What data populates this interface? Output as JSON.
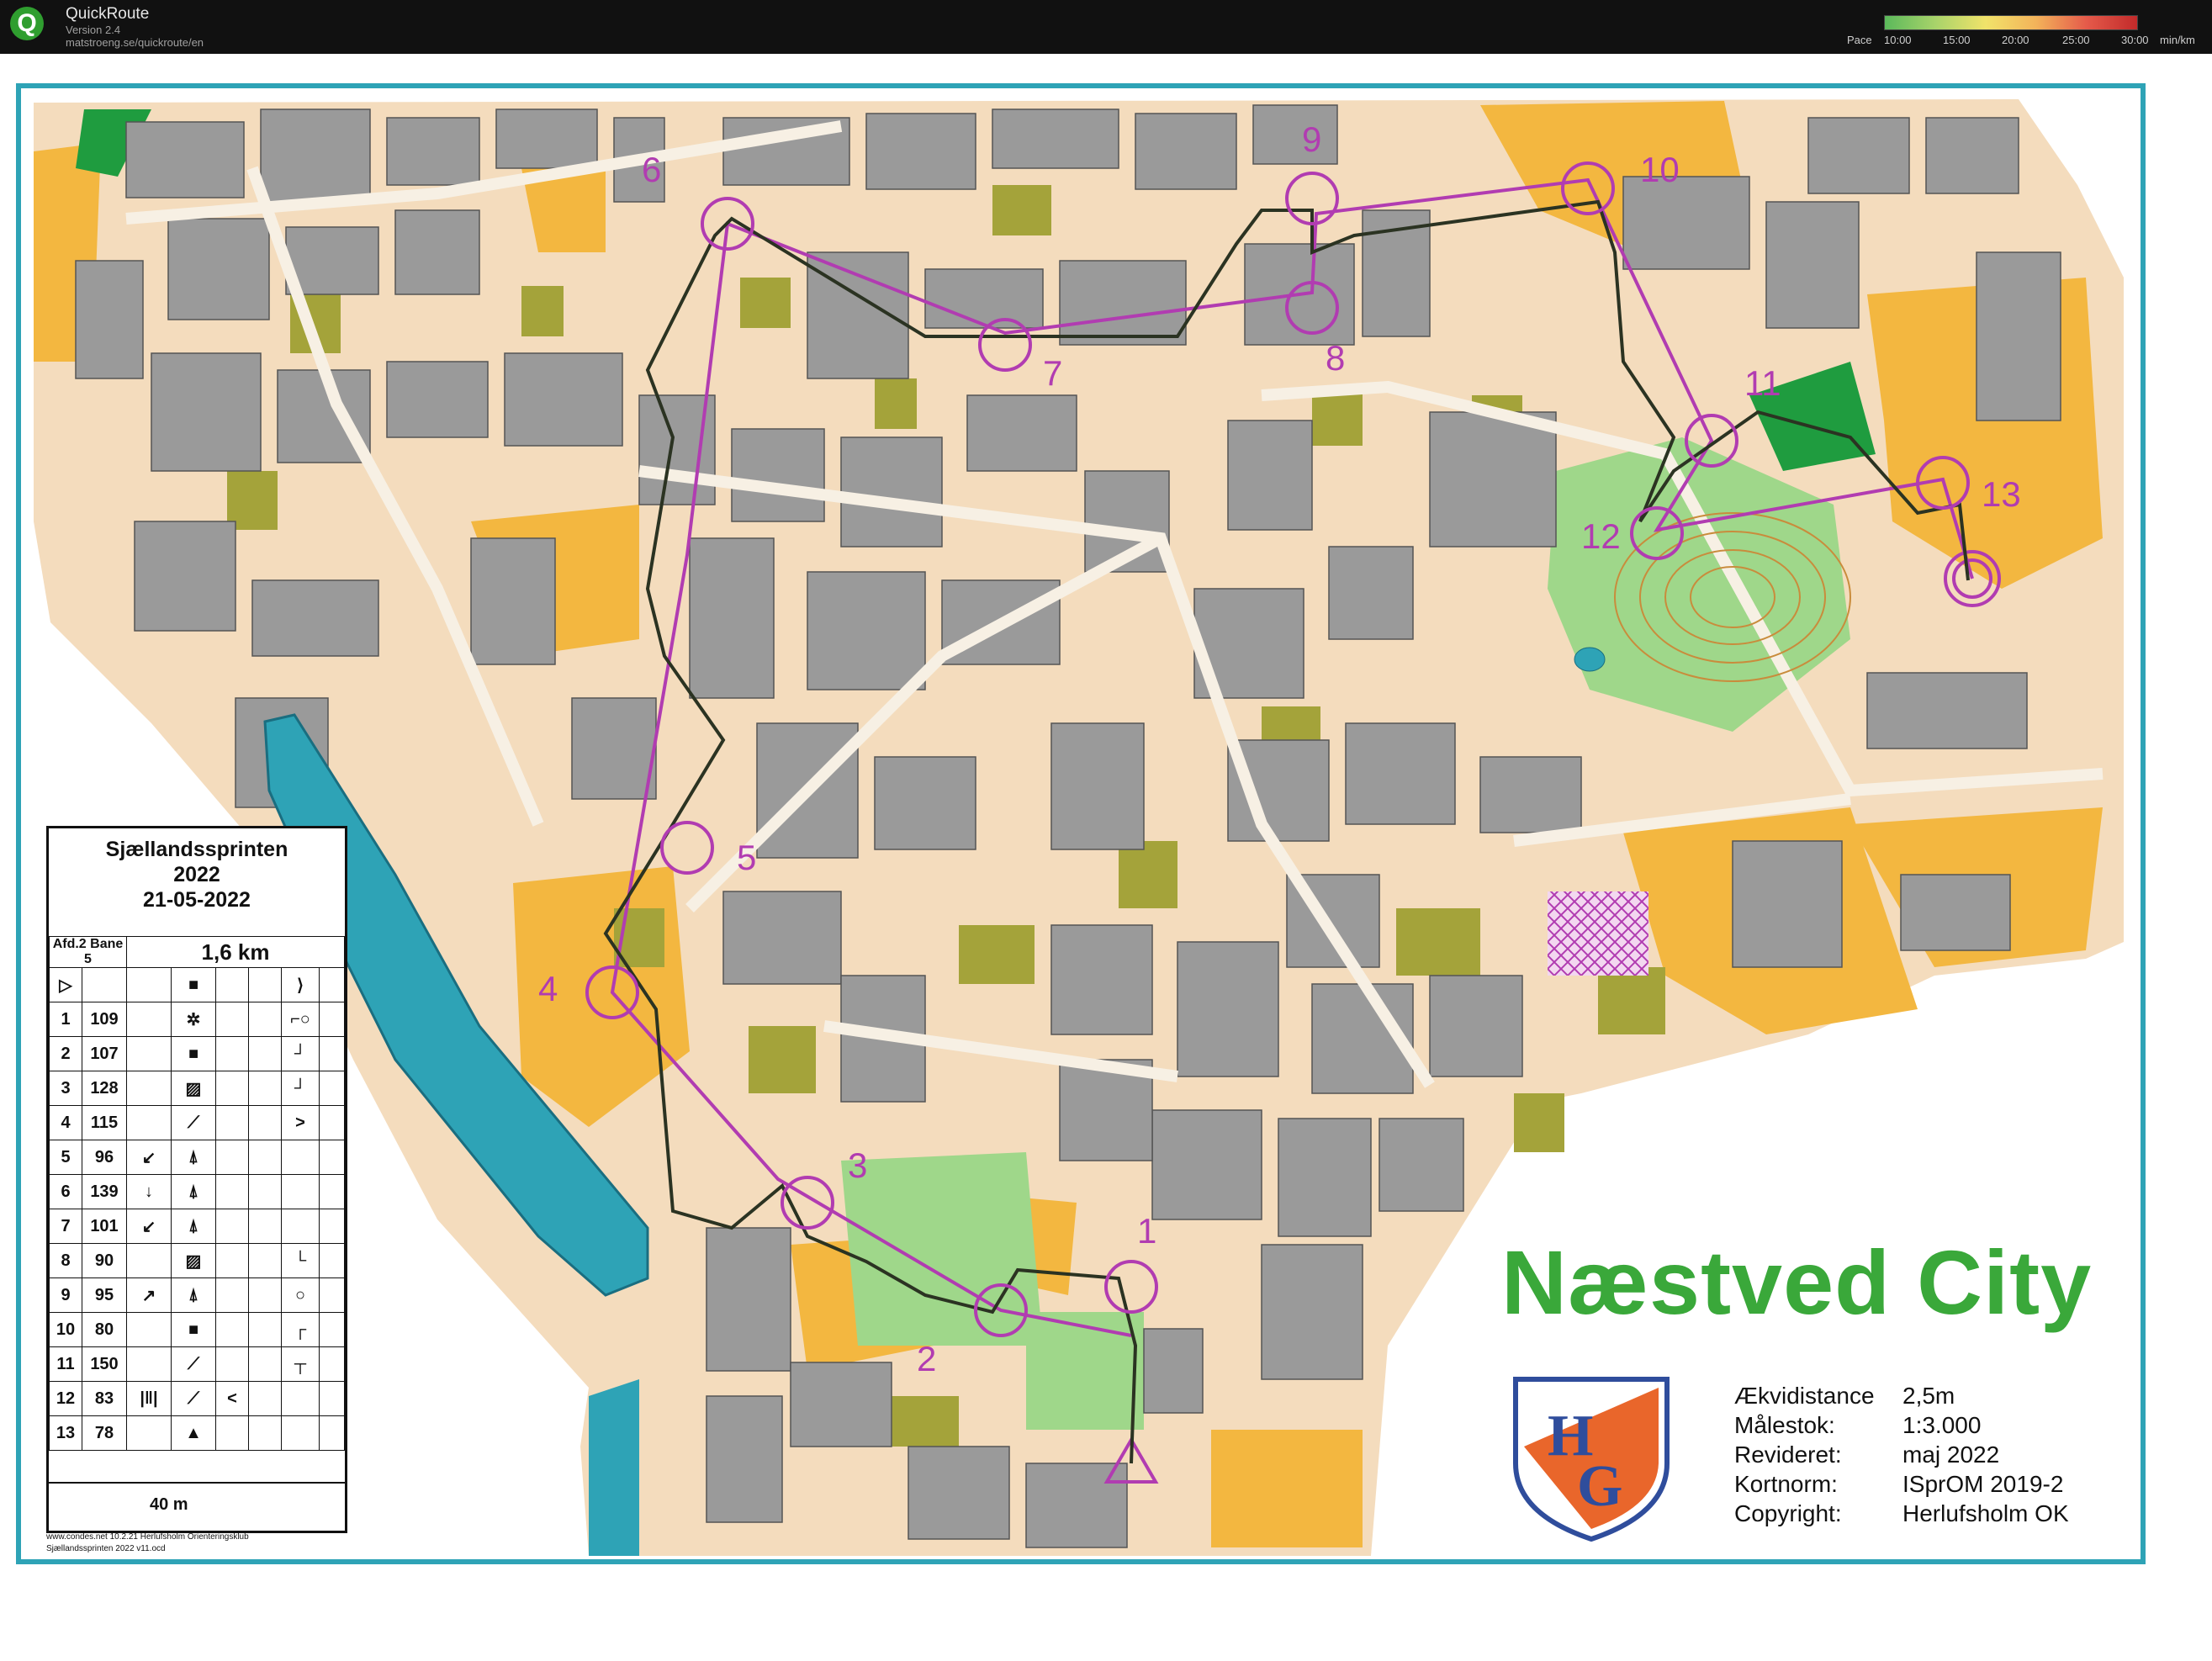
{
  "app": {
    "name": "QuickRoute",
    "version": "Version 2.4",
    "url": "matstroeng.se/quickroute/en",
    "pace_label": "Pace",
    "pace_ticks": [
      "10:00",
      "15:00",
      "20:00",
      "25:00",
      "30:00"
    ],
    "pace_unit": "min/km"
  },
  "map": {
    "title": "Næstved City",
    "logo_letters": [
      "H",
      "G"
    ],
    "controls": [
      "1",
      "2",
      "3",
      "4",
      "5",
      "6",
      "7",
      "8",
      "9",
      "10",
      "11",
      "12",
      "13"
    ],
    "info": [
      {
        "label": "Ækvidistance",
        "value": "2,5m"
      },
      {
        "label": "Målestok:",
        "value": "1:3.000"
      },
      {
        "label": "Revideret:",
        "value": "maj 2022"
      },
      {
        "label": "Kortnorm:",
        "value": "ISprOM 2019-2"
      },
      {
        "label": "Copyright:",
        "value": "Herlufsholm OK"
      }
    ],
    "colors": {
      "route": "#2b3322",
      "course": "#b13cb1",
      "title": "#3aa83a",
      "water": "#2ea3b6"
    }
  },
  "legend": {
    "event": "Sjællandssprinten",
    "year": "2022",
    "date": "21-05-2022",
    "class": "Afd.2",
    "course": "Bane 5",
    "distance": "1,6 km",
    "rows": [
      {
        "n": "1",
        "code": "109",
        "dir": "",
        "feat": "✲",
        "detail": "",
        "loc": "⌐○"
      },
      {
        "n": "2",
        "code": "107",
        "dir": "",
        "feat": "■",
        "detail": "",
        "loc": "┘"
      },
      {
        "n": "3",
        "code": "128",
        "dir": "",
        "feat": "▨",
        "detail": "",
        "loc": "┘"
      },
      {
        "n": "4",
        "code": "115",
        "dir": "",
        "feat": "⟋",
        "detail": "",
        "loc": ">"
      },
      {
        "n": "5",
        "code": "96",
        "dir": "↙",
        "feat": "⍋",
        "detail": "",
        "loc": ""
      },
      {
        "n": "6",
        "code": "139",
        "dir": "↓",
        "feat": "⍋",
        "detail": "",
        "loc": ""
      },
      {
        "n": "7",
        "code": "101",
        "dir": "↙",
        "feat": "⍋",
        "detail": "",
        "loc": ""
      },
      {
        "n": "8",
        "code": "90",
        "dir": "",
        "feat": "▨",
        "detail": "",
        "loc": "└"
      },
      {
        "n": "9",
        "code": "95",
        "dir": "↗",
        "feat": "⍋",
        "detail": "",
        "loc": "○"
      },
      {
        "n": "10",
        "code": "80",
        "dir": "",
        "feat": "■",
        "detail": "",
        "loc": "┌"
      },
      {
        "n": "11",
        "code": "150",
        "dir": "",
        "feat": "⟋",
        "detail": "",
        "loc": "┬"
      },
      {
        "n": "12",
        "code": "83",
        "dir": "|‖|",
        "feat": "⟋",
        "detail": "<",
        "loc": ""
      },
      {
        "n": "13",
        "code": "78",
        "dir": "",
        "feat": "▲",
        "detail": "",
        "loc": ""
      }
    ],
    "finish": "40 m",
    "credit1": "www.condes.net 10.2.21 Herlufsholm Orienteringsklub",
    "credit2": "Sjællandssprinten 2022 v11.ocd"
  }
}
